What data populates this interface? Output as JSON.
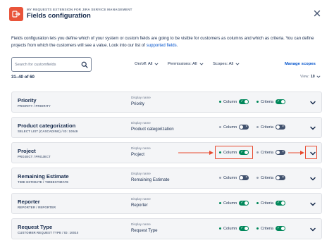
{
  "header": {
    "subtitle": "MY REQUESTS EXTENSION FOR JIRA SERVICE MANAGEMENT",
    "title": "Fields configuration"
  },
  "description": {
    "text": "Fields configuration lets you define which of your system or custom fields are going to be visible for customers as columns and which as criteria. You can define projects from which the customers will see a value. Look into our list of ",
    "link": "supported fields",
    "end": "."
  },
  "search": {
    "placeholder": "Search for customfields",
    "value": ""
  },
  "filters": {
    "onoff": "On/off: All",
    "permissions": "Permissions: All",
    "scopes": "Scopes: All"
  },
  "manage_scopes": "Manage scopes",
  "results_count": "31–40 of 60",
  "view": {
    "label": "View:",
    "value": "10"
  },
  "labels": {
    "display_name": "Display name",
    "column": "Column",
    "criteria": "Criteria"
  },
  "rows": [
    {
      "name": "Priority",
      "meta": "PRIORITY / PRIORITY",
      "display_name": "Priority",
      "column_on": true,
      "criteria_on": true
    },
    {
      "name": "Product categorization",
      "meta": "SELECT LIST (CASCADING) / ID: 10049",
      "display_name": "Product categorization",
      "column_on": false,
      "criteria_on": false
    },
    {
      "name": "Project",
      "meta": "PROJECT / PROJECT",
      "display_name": "Project",
      "column_on": true,
      "criteria_on": false
    },
    {
      "name": "Remaining Estimate",
      "meta": "TIME ESTIMATE / TIMEESTIMATE",
      "display_name": "Remaining Estimate",
      "column_on": false,
      "criteria_on": false
    },
    {
      "name": "Reporter",
      "meta": "REPORTER / REPORTER",
      "display_name": "Reporter",
      "column_on": true,
      "criteria_on": true
    },
    {
      "name": "Request Type",
      "meta": "CUSTOMER REQUEST TYPE / ID: 10010",
      "display_name": "Request Type",
      "column_on": true,
      "criteria_on": true
    }
  ],
  "colors": {
    "accent": "#0052cc",
    "toggle_on": "#00875a",
    "toggle_off": "#42526e",
    "logo": "#e9543a",
    "annotation": "#e84a2f"
  },
  "icons": [
    "request-logo-icon",
    "close-icon",
    "search-icon",
    "chevron-down-icon",
    "check-icon",
    "cross-icon"
  ]
}
